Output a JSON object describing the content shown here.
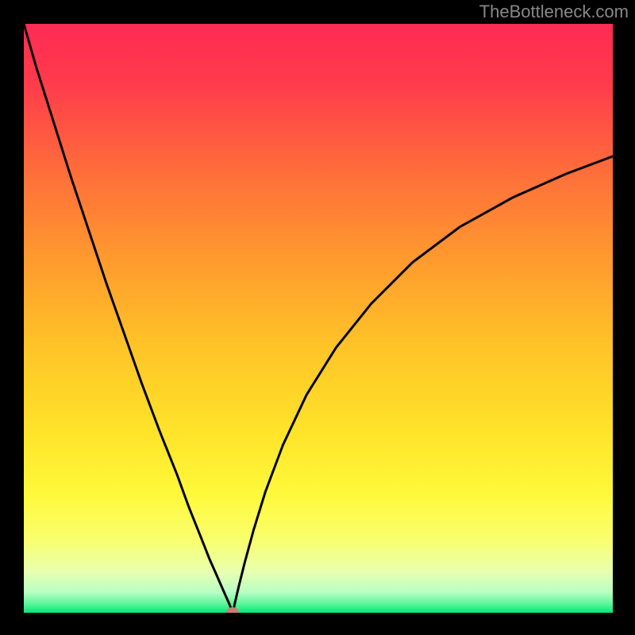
{
  "watermark": "TheBottleneck.com",
  "chart_data": {
    "type": "line",
    "title": "",
    "xlabel": "",
    "ylabel": "",
    "xlim": [
      0,
      100
    ],
    "ylim": [
      0,
      100
    ],
    "background_gradient": {
      "stops": [
        {
          "pos": 0.0,
          "color": "#ff2b53"
        },
        {
          "pos": 0.1,
          "color": "#ff3b4c"
        },
        {
          "pos": 0.25,
          "color": "#ff6d3a"
        },
        {
          "pos": 0.4,
          "color": "#ff9a2e"
        },
        {
          "pos": 0.55,
          "color": "#ffc427"
        },
        {
          "pos": 0.7,
          "color": "#ffe52a"
        },
        {
          "pos": 0.8,
          "color": "#fff93b"
        },
        {
          "pos": 0.88,
          "color": "#f8ff71"
        },
        {
          "pos": 0.93,
          "color": "#e9ffb0"
        },
        {
          "pos": 0.965,
          "color": "#b8ffc4"
        },
        {
          "pos": 0.985,
          "color": "#5cf59a"
        },
        {
          "pos": 1.0,
          "color": "#00e878"
        }
      ]
    },
    "series": [
      {
        "name": "curve-left",
        "x": [
          0,
          2,
          5,
          8,
          11,
          14,
          17,
          20,
          23,
          26,
          28,
          30,
          31.5,
          33,
          34,
          34.8,
          35.3,
          35.5
        ],
        "y": [
          100,
          93,
          83.5,
          74,
          65,
          56,
          47.5,
          39,
          31,
          23.5,
          18,
          13,
          9.2,
          5.8,
          3.5,
          1.7,
          0.5,
          0
        ]
      },
      {
        "name": "curve-right",
        "x": [
          35.5,
          35.8,
          36.5,
          37.5,
          39,
          41,
          44,
          48,
          53,
          59,
          66,
          74,
          83,
          92,
          100
        ],
        "y": [
          0,
          1.5,
          4.5,
          8.5,
          14,
          20.5,
          28.5,
          37,
          45,
          52.5,
          59.5,
          65.5,
          70.5,
          74.5,
          77.5
        ]
      }
    ],
    "min_point": {
      "x": 35.5,
      "y": 0,
      "color": "#c97d72"
    }
  }
}
